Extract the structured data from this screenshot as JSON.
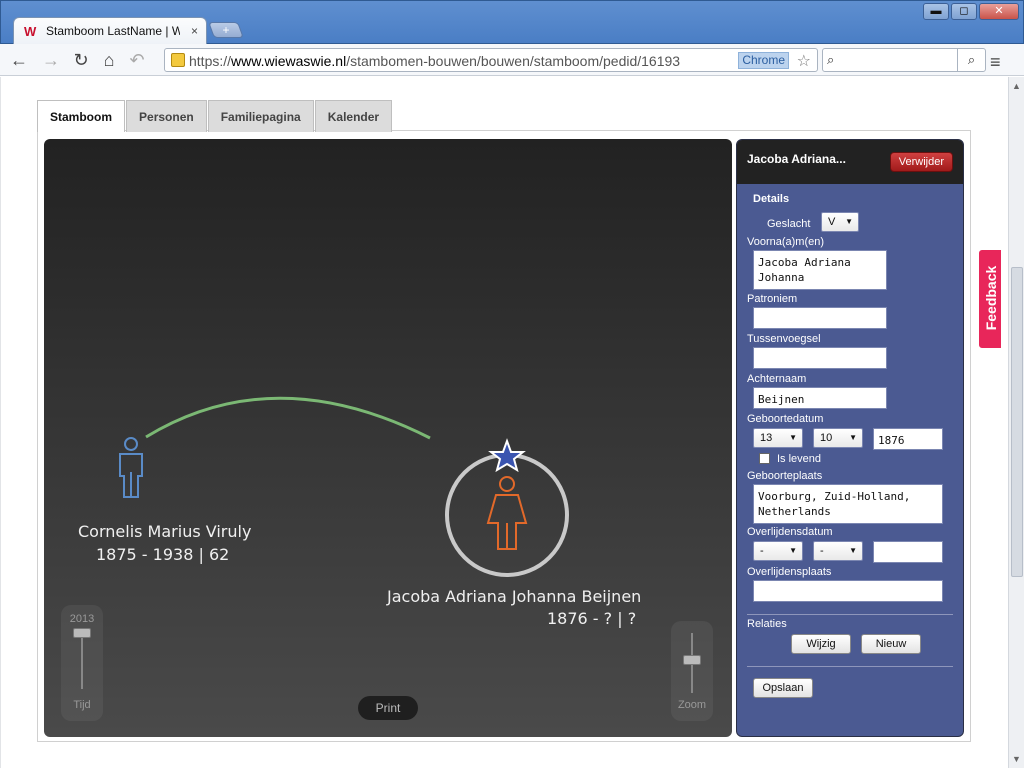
{
  "browser": {
    "tab_title": "Stamboom LastName | Wi",
    "tab_close": "×",
    "new_tab": "+",
    "url_prefix": "https://",
    "url_host": "www.wiewaswie.nl",
    "url_path": "/stambomen-bouwen/bouwen/stamboom/pedid/16193",
    "url_badge": "Chrome",
    "window_buttons": {
      "minimize": "▬",
      "maximize": "◻",
      "close": "✕"
    }
  },
  "tabs": [
    {
      "label": "Stamboom",
      "active": true
    },
    {
      "label": "Personen",
      "active": false
    },
    {
      "label": "Familiepagina",
      "active": false
    },
    {
      "label": "Kalender",
      "active": false
    }
  ],
  "tree": {
    "person1": {
      "name": "Cornelis Marius Viruly",
      "dates": "1875 - 1938 | 62",
      "gender": "male",
      "color": "#5a8bc7"
    },
    "person2": {
      "name": "Jacoba Adriana Johanna Beijnen",
      "dates": "1876 - ? | ?",
      "gender": "female",
      "color": "#e2692a",
      "selected": true
    },
    "relation_color": "#7bb874",
    "star_color": "#3b55b0"
  },
  "controls": {
    "time_label": "Tijd",
    "time_value": "2013",
    "zoom_label": "Zoom",
    "print_label": "Print"
  },
  "panel": {
    "header_name": "Jacoba Adriana...",
    "delete_label": "Verwijder",
    "details_title": "Details",
    "gender_label": "Geslacht",
    "gender_value": "V",
    "firstnames_label": "Voorna(a)m(en)",
    "firstnames_value": "Jacoba Adriana\nJohanna",
    "patronym_label": "Patroniem",
    "patronym_value": "",
    "infix_label": "Tussenvoegsel",
    "infix_value": "",
    "lastname_label": "Achternaam",
    "lastname_value": "Beijnen",
    "birthdate_label": "Geboortedatum",
    "birth_day": "13",
    "birth_month": "10",
    "birth_year": "1876",
    "alive_label": "Is levend",
    "birthplace_label": "Geboorteplaats",
    "birthplace_value": "Voorburg, Zuid-Holland,\nNetherlands",
    "deathdate_label": "Overlijdensdatum",
    "death_day": "-",
    "death_month": "-",
    "death_year": "",
    "deathplace_label": "Overlijdensplaats",
    "deathplace_value": "",
    "relations_label": "Relaties",
    "edit_label": "Wijzig",
    "new_label": "Nieuw",
    "save_label": "Opslaan"
  },
  "feedback_label": "Feedback"
}
